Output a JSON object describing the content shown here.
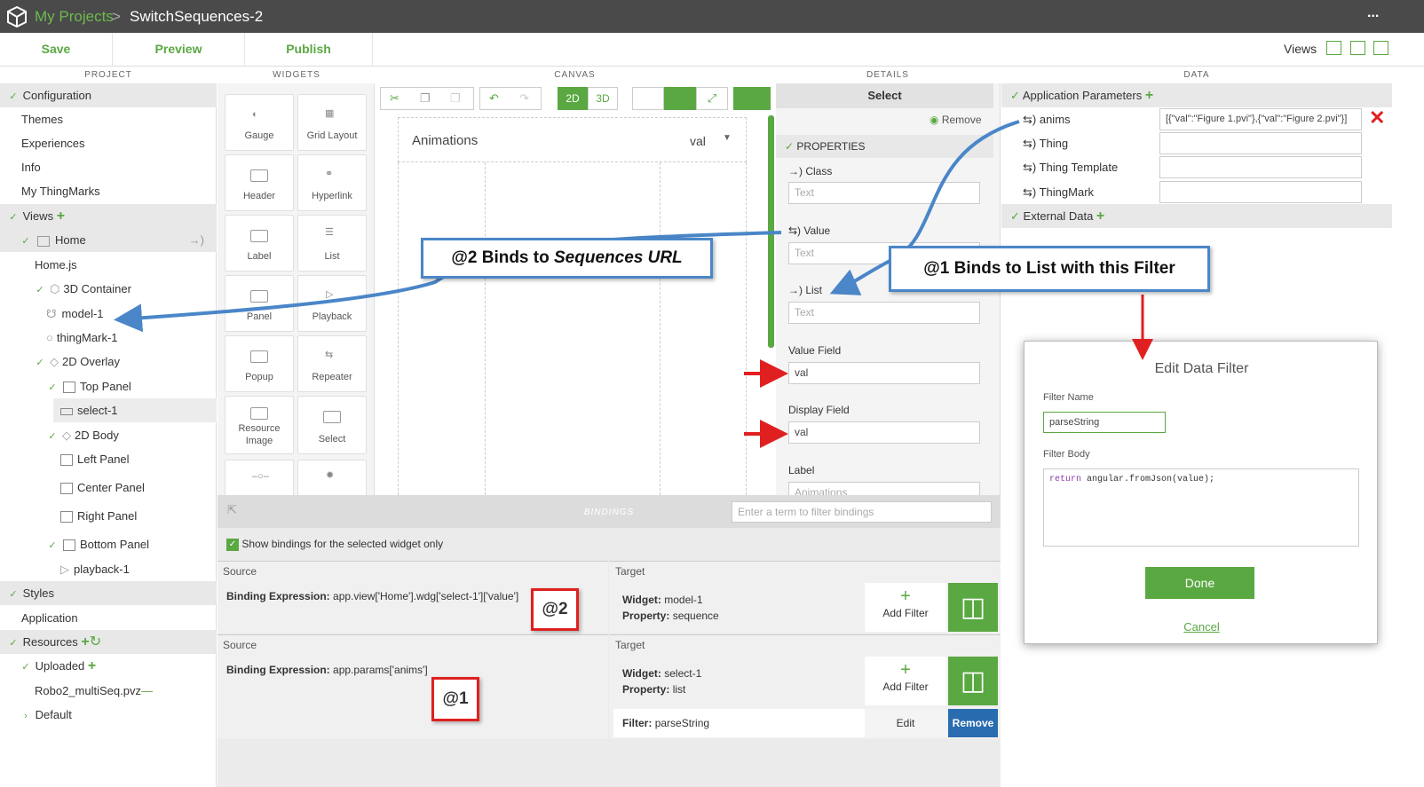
{
  "titlebar": {
    "crumb": "My Projects",
    "sep": ">",
    "title": "SwitchSequences-2",
    "menu": "..."
  },
  "toolbar": {
    "save": "Save",
    "preview": "Preview",
    "publish": "Publish",
    "views": "Views"
  },
  "columns": {
    "project": "PROJECT",
    "widgets": "WIDGETS",
    "canvas": "CANVAS",
    "details": "DETAILS",
    "data": "DATA"
  },
  "project": {
    "configuration": "Configuration",
    "themes": "Themes",
    "experiences": "Experiences",
    "info": "Info",
    "thingmarks": "My ThingMarks",
    "views": "Views",
    "home": "Home",
    "homejs": "Home.js",
    "container3d": "3D Container",
    "model1": "model-1",
    "thingmark1": "thingMark-1",
    "overlay2d": "2D Overlay",
    "toppanel": "Top Panel",
    "select1": "select-1",
    "body2d": "2D Body",
    "leftpanel": "Left Panel",
    "centerpanel": "Center Panel",
    "rightpanel": "Right Panel",
    "bottompanel": "Bottom Panel",
    "playback1": "playback-1",
    "styles": "Styles",
    "application": "Application",
    "resources": "Resources",
    "uploaded": "Uploaded",
    "pvz": "Robo2_multiSeq.pvz",
    "default": "Default"
  },
  "widgets": {
    "gauge": "Gauge",
    "grid": "Grid Layout",
    "header": "Header",
    "hyperlink": "Hyperlink",
    "label": "Label",
    "list": "List",
    "panel": "Panel",
    "playback": "Playback",
    "popup": "Popup",
    "repeater": "Repeater",
    "resimage_a": "Resource",
    "resimage_b": "Image",
    "select": "Select"
  },
  "canvas": {
    "mode2d": "2D",
    "mode3d": "3D",
    "select_label": "Animations",
    "select_value": "val"
  },
  "details": {
    "title": "Select",
    "remove": "Remove",
    "properties": "PROPERTIES",
    "class": "Class",
    "value": "Value",
    "list": "List",
    "text_ph": "Text",
    "valuefield": "Value Field",
    "valuefield_val": "val",
    "displayfield": "Display Field",
    "displayfield_val": "val",
    "label": "Label",
    "label_val": "Animations"
  },
  "data": {
    "appparams": "Application Parameters",
    "anims": "anims",
    "anims_val": "[{\"val\":\"Figure 1.pvi\"},{\"val\":\"Figure 2.pvi\"}]",
    "thing": "Thing",
    "thingtemplate": "Thing Template",
    "thingmark": "ThingMark",
    "external": "External Data"
  },
  "filter": {
    "title": "Edit Data Filter",
    "name_label": "Filter Name",
    "name_val": "parseString",
    "body_label": "Filter Body",
    "body_kw": "return",
    "body_rest": " angular.fromJson(value);",
    "done": "Done",
    "cancel": "Cancel"
  },
  "bindings": {
    "title": "BINDINGS",
    "search_ph": "Enter a term to filter bindings",
    "show_selected": "Show bindings for the selected widget only",
    "source": "Source",
    "target": "Target",
    "expr_label": "Binding Expression:",
    "b1_expr": "app.view['Home'].wdg['select-1']['value']",
    "b1_widget": "model-1",
    "b1_prop": "sequence",
    "b2_expr": "app.params['anims']",
    "b2_widget": "select-1",
    "b2_prop": "list",
    "widget_label": "Widget:",
    "prop_label": "Property:",
    "add_filter": "Add Filter",
    "filter_label": "Filter:",
    "filter_val": "parseString",
    "edit": "Edit",
    "remove": "Remove"
  },
  "annotations": {
    "c2a": "@2 Binds to ",
    "c2b": "Sequences URL",
    "c1": "@1 Binds to List with this Filter",
    "r2": "@2",
    "r1": "@1"
  },
  "colors": {
    "accent": "#5aa842",
    "callout": "#4a86c8",
    "arrow": "#e02020"
  }
}
